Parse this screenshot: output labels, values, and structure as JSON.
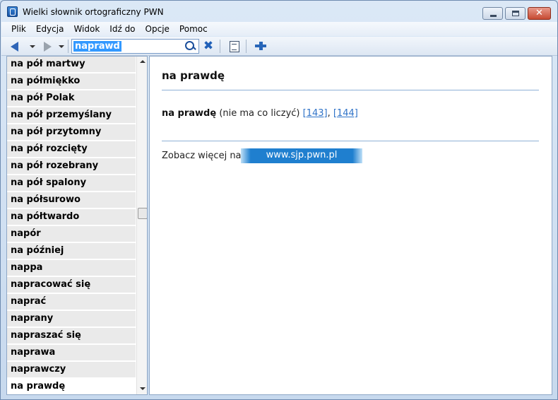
{
  "window": {
    "title": "Wielki słownik ortograficzny PWN"
  },
  "menu": [
    "Plik",
    "Edycja",
    "Widok",
    "Idź do",
    "Opcje",
    "Pomoc"
  ],
  "toolbar": {
    "search_value": "naprawd"
  },
  "word_list": [
    "na pół martwy",
    "na półmiękko",
    "na pół Polak",
    "na pół przemyślany",
    "na pół przytomny",
    "na pół rozcięty",
    "na pół rozebrany",
    "na pół spalony",
    "na półsurowo",
    "na półtwardo",
    "napór",
    "na później",
    "nappa",
    "napracować się",
    "naprać",
    "naprany",
    "napraszać się",
    "naprawa",
    "naprawczy",
    "na prawdę"
  ],
  "selected_index": 19,
  "entry": {
    "heading": "na prawdę",
    "term": "na prawdę",
    "note": "(nie ma co liczyć)",
    "refs": [
      "[143]",
      "[144]"
    ],
    "ref_separator": ",",
    "more_label": "Zobacz więcej na",
    "more_link": "www.sjp.pwn.pl"
  },
  "colors": {
    "accent": "#1f7fcf",
    "link": "#2f73c8",
    "divider": "#8fb1d6"
  }
}
